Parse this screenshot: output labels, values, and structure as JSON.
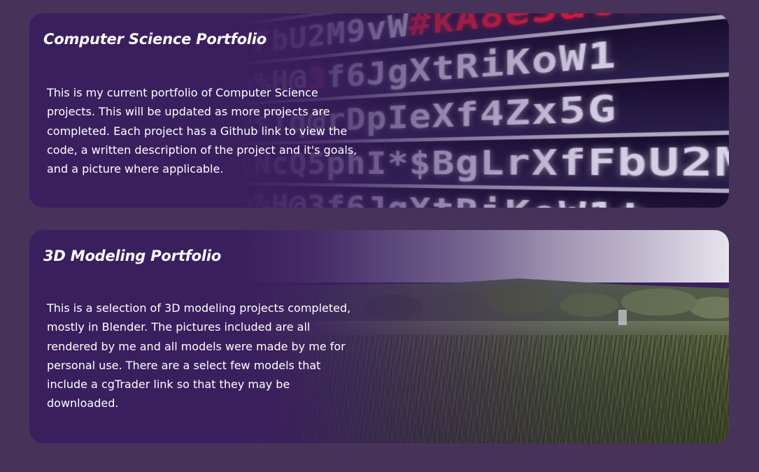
{
  "colors": {
    "page_background": "#47335a",
    "card_background": "#3a1f5e",
    "text": "#ffffff",
    "code_highlight": "#e01a3a"
  },
  "cards": [
    {
      "title": "Computer Science Portfolio",
      "description": "This is my current portfolio of Computer Science projects. This will be updated as more projects are completed. Each project has a Github link to view the code, a written description of the project and it's goals, and a picture where applicable.",
      "background_image": "code-closeup"
    },
    {
      "title": "3D Modeling Portfolio",
      "description": "This is a selection of 3D modeling projects completed, mostly in Blender. The pictures included are all rendered by me and all models were made by me for personal use. There are a select few models that include a cgTrader link so that they may be downloaded.",
      "background_image": "grass-field-render"
    }
  ]
}
